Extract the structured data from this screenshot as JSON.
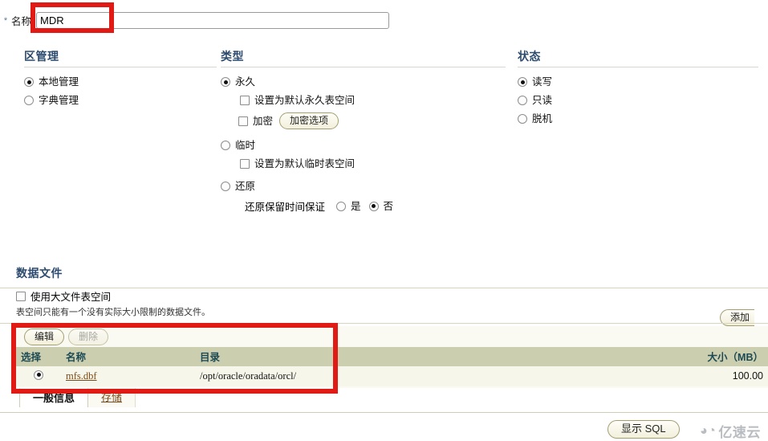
{
  "name_field": {
    "required_marker": "*",
    "label": "名称",
    "value": "MDR",
    "placeholder": ""
  },
  "extent_management": {
    "heading": "区管理",
    "options": [
      {
        "label": "本地管理",
        "selected": true
      },
      {
        "label": "字典管理",
        "selected": false
      }
    ]
  },
  "type_section": {
    "heading": "类型",
    "permanent": {
      "label": "永久",
      "selected": true,
      "default_permanent_checkbox": "设置为默认永久表空间",
      "encrypt_checkbox": "加密",
      "encrypt_options_button": "加密选项"
    },
    "temporary": {
      "label": "临时",
      "selected": false,
      "default_temp_checkbox": "设置为默认临时表空间"
    },
    "undo": {
      "label": "还原",
      "selected": false,
      "retention_label": "还原保留时间保证",
      "yes_label": "是",
      "no_label": "否",
      "yes_selected": false,
      "no_selected": true
    }
  },
  "status_section": {
    "heading": "状态",
    "options": [
      {
        "label": "读写",
        "selected": true
      },
      {
        "label": "只读",
        "selected": false
      },
      {
        "label": "脱机",
        "selected": false
      }
    ]
  },
  "datafiles": {
    "heading": "数据文件",
    "bigfile_checkbox": {
      "label": "使用大文件表空间",
      "checked": false
    },
    "note": "表空间只能有一个没有实际大小限制的数据文件。",
    "add_button": "添加",
    "toolbar": {
      "edit_button": "编辑",
      "delete_button": "删除",
      "delete_disabled": true
    },
    "columns": [
      "选择",
      "名称",
      "目录",
      "大小（MB）"
    ],
    "rows": [
      {
        "selected": true,
        "name": "mfs.dbf",
        "directory": "/opt/oracle/oradata/orcl/",
        "size": "100.00"
      }
    ]
  },
  "tabs": [
    {
      "label": "一般信息",
      "active": true
    },
    {
      "label": "存储",
      "active": false
    }
  ],
  "footer": {
    "show_sql_button": "显示 SQL",
    "watermark_text": "亿速云"
  },
  "colors": {
    "heading_blue": "#2c4b6e",
    "table_header_bg": "#ccceb0",
    "table_header_text": "#1c4a53",
    "row_bg": "#f7f6ea",
    "link_brown": "#7a4a18",
    "annotation_red": "#e01b15",
    "button_border": "#a39f73"
  }
}
